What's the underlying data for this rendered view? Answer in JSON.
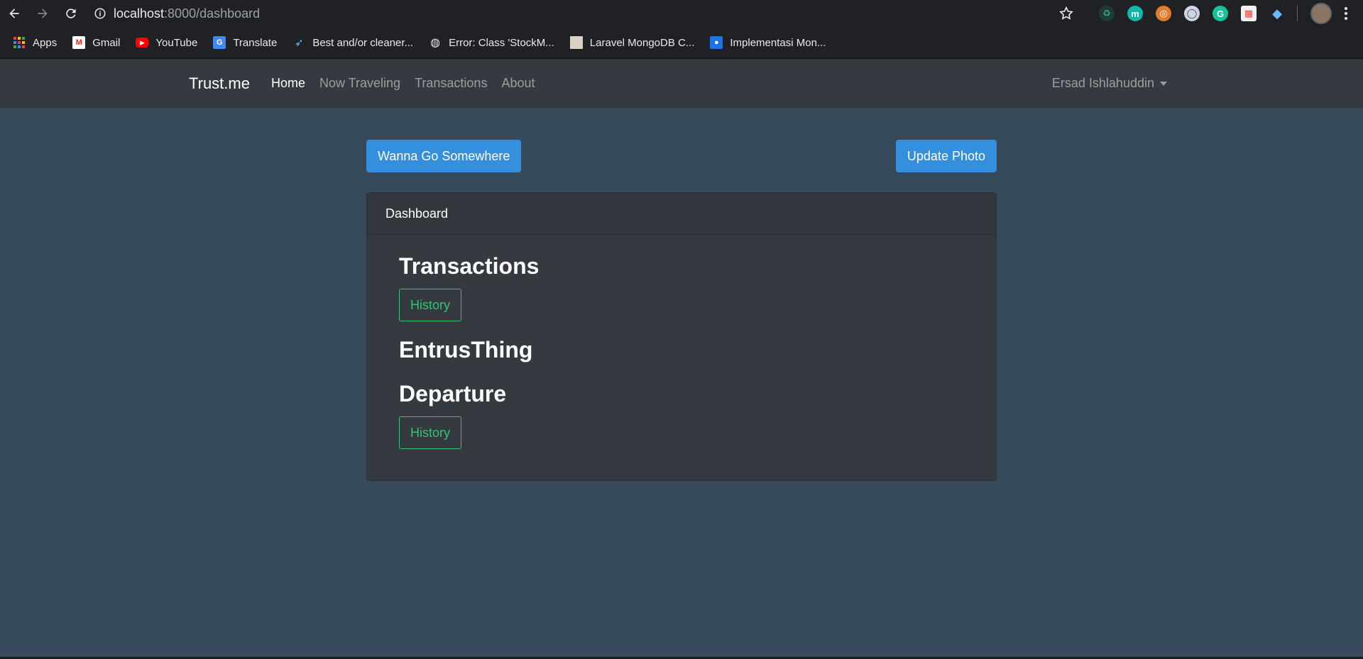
{
  "browser": {
    "url_host": "localhost",
    "url_path": ":8000/dashboard",
    "bookmarks": [
      {
        "label": "Apps",
        "icon": "apps-grid-icon"
      },
      {
        "label": "Gmail",
        "icon": "gmail-icon"
      },
      {
        "label": "YouTube",
        "icon": "youtube-icon"
      },
      {
        "label": "Translate",
        "icon": "translate-icon"
      },
      {
        "label": "Best and/or cleaner...",
        "icon": "rocket-icon"
      },
      {
        "label": "Error: Class 'StockM...",
        "icon": "globe-icon"
      },
      {
        "label": "Laravel MongoDB C...",
        "icon": "page-thumbnail-icon"
      },
      {
        "label": "Implementasi Mon...",
        "icon": "person-icon"
      }
    ]
  },
  "navbar": {
    "brand": "Trust.me",
    "links": [
      {
        "label": "Home",
        "active": true
      },
      {
        "label": "Now Traveling",
        "active": false
      },
      {
        "label": "Transactions",
        "active": false
      },
      {
        "label": "About",
        "active": false
      }
    ],
    "user": "Ersad Ishlahuddin"
  },
  "actions": {
    "left_button": "Wanna Go Somewhere",
    "right_button": "Update Photo"
  },
  "card": {
    "header": "Dashboard",
    "sections": [
      {
        "title": "Transactions",
        "button": "History"
      },
      {
        "title": "EntrusThing"
      },
      {
        "title": "Departure",
        "button": "History"
      }
    ]
  },
  "colors": {
    "page_bg": "#374a5c",
    "navbar_bg": "#343a40",
    "primary": "#3490dc",
    "success": "#38c172"
  }
}
